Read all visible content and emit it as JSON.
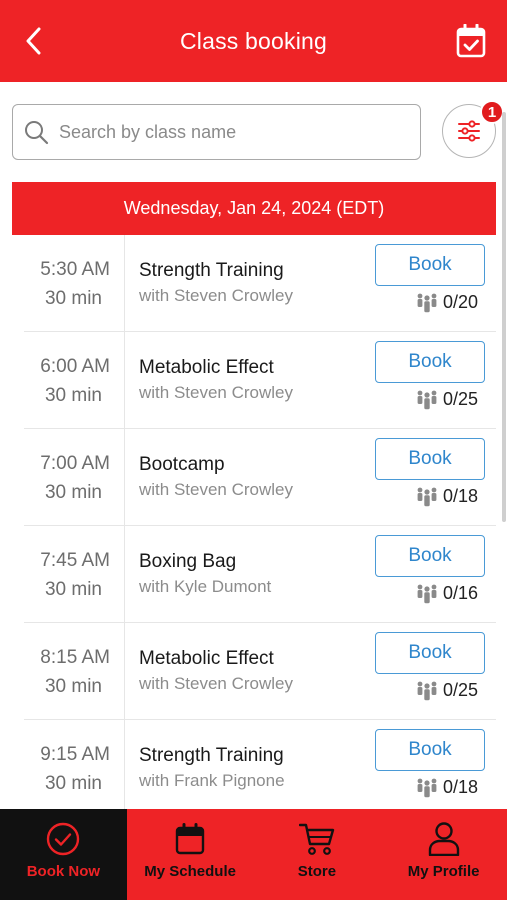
{
  "header": {
    "title": "Class booking",
    "back_icon": "back-chevron-icon",
    "calendar_icon": "calendar-check-icon"
  },
  "search": {
    "placeholder": "Search by class name",
    "value": ""
  },
  "filter": {
    "badge_count": "1"
  },
  "date": "Wednesday, Jan 24, 2024 (EDT)",
  "classes": [
    {
      "time": "5:30  AM",
      "duration": "30 min",
      "name": "Strength Training",
      "instructor": "with Steven Crowley",
      "button": "Book",
      "capacity": "0/20"
    },
    {
      "time": "6:00  AM",
      "duration": "30 min",
      "name": "Metabolic Effect",
      "instructor": "with Steven Crowley",
      "button": "Book",
      "capacity": "0/25"
    },
    {
      "time": "7:00  AM",
      "duration": "30 min",
      "name": "Bootcamp",
      "instructor": "with Steven Crowley",
      "button": "Book",
      "capacity": "0/18"
    },
    {
      "time": "7:45  AM",
      "duration": "30 min",
      "name": "Boxing Bag",
      "instructor": "with Kyle Dumont",
      "button": "Book",
      "capacity": "0/16"
    },
    {
      "time": "8:15  AM",
      "duration": "30 min",
      "name": "Metabolic Effect",
      "instructor": "with Steven Crowley",
      "button": "Book",
      "capacity": "0/25"
    },
    {
      "time": "9:15  AM",
      "duration": "30 min",
      "name": "Strength Training",
      "instructor": "with Frank Pignone",
      "button": "Book",
      "capacity": "0/18"
    }
  ],
  "tabs": [
    {
      "label": "Book Now",
      "icon": "check-circle-icon",
      "active": true
    },
    {
      "label": "My Schedule",
      "icon": "calendar-icon",
      "active": false
    },
    {
      "label": "Store",
      "icon": "cart-icon",
      "active": false
    },
    {
      "label": "My Profile",
      "icon": "person-icon",
      "active": false
    }
  ],
  "colors": {
    "brand_red": "#ee2326",
    "book_blue": "#2f86cc",
    "active_tab_bg": "#111111"
  }
}
